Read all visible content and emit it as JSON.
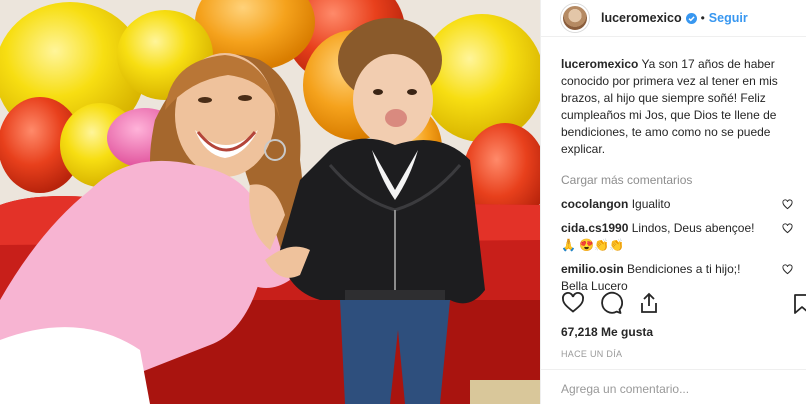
{
  "header": {
    "username": "luceromexico",
    "separator": "•",
    "follow_label": "Seguir",
    "verified_icon": "verified-badge-icon"
  },
  "caption": {
    "username": "luceromexico",
    "text": "Ya son 17 años de haber conocido por primera vez al tener en mis brazos, al hijo que siempre soñé! Feliz cumpleaños mi Jos, que Dios te llene de bendiciones, te amo como no se puede explicar."
  },
  "load_more": "Cargar más comentarios",
  "comments": [
    {
      "username": "cocolangon",
      "text": "Igualito"
    },
    {
      "username": "cida.cs1990",
      "text": "Lindos, Deus abençoe!🙏 😍👏👏"
    },
    {
      "username": "emilio.osin",
      "text": "Bendiciones a ti hijo;! Bella Lucero"
    }
  ],
  "actions": {
    "like_icon": "heart-icon",
    "comment_icon": "comment-icon",
    "share_icon": "share-icon",
    "save_icon": "bookmark-icon"
  },
  "likes": "67,218 Me gusta",
  "timestamp": "Hace un día",
  "add_comment_placeholder": "Agrega un comentario...",
  "colors": {
    "link_blue": "#3897f0",
    "text": "#262626",
    "muted": "#8e8e8e",
    "border": "#efefef"
  }
}
